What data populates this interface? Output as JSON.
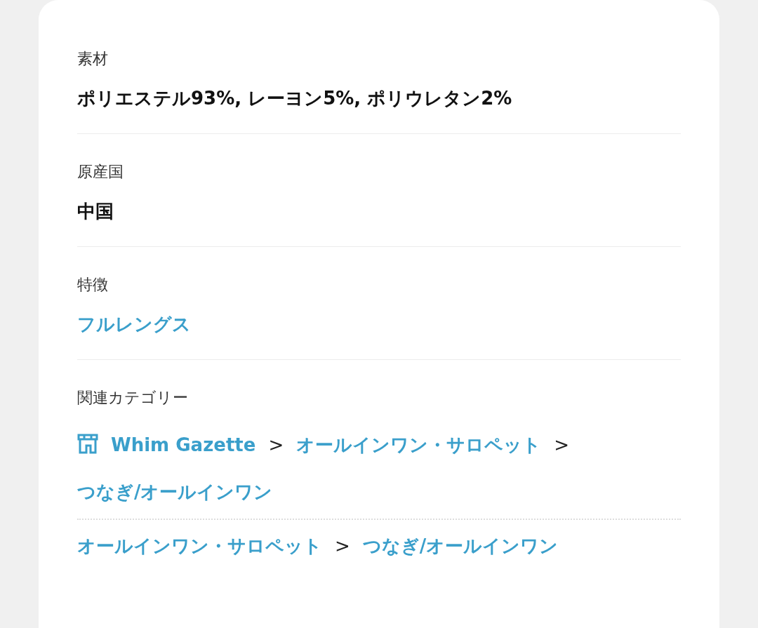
{
  "details": [
    {
      "label": "素材",
      "value": "ポリエステル93%, レーヨン5%, ポリウレタン2%",
      "kind": "text"
    },
    {
      "label": "原産国",
      "value": "中国",
      "kind": "text"
    },
    {
      "label": "特徴",
      "value": "フルレングス",
      "kind": "link"
    }
  ],
  "related_categories": {
    "label": "関連カテゴリー",
    "paths": [
      {
        "separator": ">",
        "items": [
          {
            "text": "Whim Gazette",
            "kind": "store"
          },
          {
            "text": "オールインワン・サロペット",
            "kind": "category"
          },
          {
            "text": "つなぎ/オールインワン",
            "kind": "category"
          }
        ]
      },
      {
        "separator": ">",
        "items": [
          {
            "text": "オールインワン・サロペット",
            "kind": "category"
          },
          {
            "text": "つなぎ/オールインワン",
            "kind": "category"
          }
        ]
      }
    ]
  }
}
